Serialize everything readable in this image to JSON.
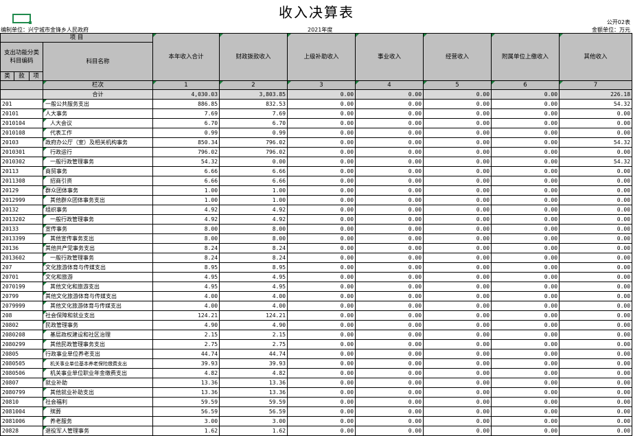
{
  "title": "收入决算表",
  "form_no": "公开02表",
  "unit_label": "编制单位：兴宁城市金锋乡人民政府",
  "year": "2021年度",
  "money_unit": "金额单位：万元",
  "header": {
    "item": "项    目",
    "func_code": "支出功能分类科目编码",
    "subject_name": "科目名称",
    "lei": "类",
    "kuan": "款",
    "xiang": "项",
    "lanci": "栏次",
    "columns": [
      "本年收入合计",
      "财政拨款收入",
      "上级补助收入",
      "事业收入",
      "经营收入",
      "附属单位上缴收入",
      "其他收入"
    ],
    "col_nums": [
      "1",
      "2",
      "3",
      "4",
      "5",
      "6",
      "7"
    ]
  },
  "total_label": "合计",
  "total_values": [
    "4,030.03",
    "3,803.85",
    "0.00",
    "0.00",
    "0.00",
    "0.00",
    "226.18"
  ],
  "rows": [
    {
      "code": "201",
      "name": "一般公共服务支出",
      "level": 1,
      "values": [
        "886.85",
        "832.53",
        "0.00",
        "0.00",
        "0.00",
        "0.00",
        "54.32"
      ]
    },
    {
      "code": "20101",
      "name": "人大事务",
      "level": 1,
      "values": [
        "7.69",
        "7.69",
        "0.00",
        "0.00",
        "0.00",
        "0.00",
        "0.00"
      ]
    },
    {
      "code": "2010104",
      "name": "人大会议",
      "level": 2,
      "values": [
        "6.70",
        "6.70",
        "0.00",
        "0.00",
        "0.00",
        "0.00",
        "0.00"
      ]
    },
    {
      "code": "2010108",
      "name": "代表工作",
      "level": 2,
      "values": [
        "0.99",
        "0.99",
        "0.00",
        "0.00",
        "0.00",
        "0.00",
        "0.00"
      ]
    },
    {
      "code": "20103",
      "name": "政府办公厅（室）及相关机构事务",
      "level": 1,
      "values": [
        "850.34",
        "796.02",
        "0.00",
        "0.00",
        "0.00",
        "0.00",
        "54.32"
      ]
    },
    {
      "code": "2010301",
      "name": "行政运行",
      "level": 2,
      "values": [
        "796.02",
        "796.02",
        "0.00",
        "0.00",
        "0.00",
        "0.00",
        "0.00"
      ]
    },
    {
      "code": "2010302",
      "name": "一般行政管理事务",
      "level": 2,
      "values": [
        "54.32",
        "0.00",
        "0.00",
        "0.00",
        "0.00",
        "0.00",
        "54.32"
      ]
    },
    {
      "code": "20113",
      "name": "商贸事务",
      "level": 1,
      "values": [
        "6.66",
        "6.66",
        "0.00",
        "0.00",
        "0.00",
        "0.00",
        "0.00"
      ]
    },
    {
      "code": "2011308",
      "name": "招商引资",
      "level": 2,
      "values": [
        "6.66",
        "6.66",
        "0.00",
        "0.00",
        "0.00",
        "0.00",
        "0.00"
      ]
    },
    {
      "code": "20129",
      "name": "群众团体事务",
      "level": 1,
      "values": [
        "1.00",
        "1.00",
        "0.00",
        "0.00",
        "0.00",
        "0.00",
        "0.00"
      ]
    },
    {
      "code": "2012999",
      "name": "其他群众团体事务支出",
      "level": 2,
      "values": [
        "1.00",
        "1.00",
        "0.00",
        "0.00",
        "0.00",
        "0.00",
        "0.00"
      ]
    },
    {
      "code": "20132",
      "name": "组织事务",
      "level": 1,
      "values": [
        "4.92",
        "4.92",
        "0.00",
        "0.00",
        "0.00",
        "0.00",
        "0.00"
      ]
    },
    {
      "code": "2013202",
      "name": "一般行政管理事务",
      "level": 2,
      "values": [
        "4.92",
        "4.92",
        "0.00",
        "0.00",
        "0.00",
        "0.00",
        "0.00"
      ]
    },
    {
      "code": "20133",
      "name": "宣传事务",
      "level": 1,
      "values": [
        "8.00",
        "8.00",
        "0.00",
        "0.00",
        "0.00",
        "0.00",
        "0.00"
      ]
    },
    {
      "code": "2013399",
      "name": "其他宣传事务支出",
      "level": 2,
      "values": [
        "8.00",
        "8.00",
        "0.00",
        "0.00",
        "0.00",
        "0.00",
        "0.00"
      ]
    },
    {
      "code": "20136",
      "name": "其他共产党事务支出",
      "level": 1,
      "values": [
        "8.24",
        "8.24",
        "0.00",
        "0.00",
        "0.00",
        "0.00",
        "0.00"
      ]
    },
    {
      "code": "2013602",
      "name": "一般行政管理事务",
      "level": 2,
      "values": [
        "8.24",
        "8.24",
        "0.00",
        "0.00",
        "0.00",
        "0.00",
        "0.00"
      ]
    },
    {
      "code": "207",
      "name": "文化旅游体育与传媒支出",
      "level": 1,
      "values": [
        "8.95",
        "8.95",
        "0.00",
        "0.00",
        "0.00",
        "0.00",
        "0.00"
      ]
    },
    {
      "code": "20701",
      "name": "文化和旅游",
      "level": 1,
      "values": [
        "4.95",
        "4.95",
        "0.00",
        "0.00",
        "0.00",
        "0.00",
        "0.00"
      ]
    },
    {
      "code": "2070199",
      "name": "其他文化和旅游支出",
      "level": 2,
      "values": [
        "4.95",
        "4.95",
        "0.00",
        "0.00",
        "0.00",
        "0.00",
        "0.00"
      ]
    },
    {
      "code": "20799",
      "name": "其他文化旅游体育与传媒支出",
      "level": 1,
      "values": [
        "4.00",
        "4.00",
        "0.00",
        "0.00",
        "0.00",
        "0.00",
        "0.00"
      ]
    },
    {
      "code": "2079999",
      "name": "其他文化旅游体育与传媒支出",
      "level": 2,
      "values": [
        "4.00",
        "4.00",
        "0.00",
        "0.00",
        "0.00",
        "0.00",
        "0.00"
      ]
    },
    {
      "code": "208",
      "name": "社会保障和就业支出",
      "level": 1,
      "values": [
        "124.21",
        "124.21",
        "0.00",
        "0.00",
        "0.00",
        "0.00",
        "0.00"
      ]
    },
    {
      "code": "20802",
      "name": "民政管理事务",
      "level": 1,
      "values": [
        "4.90",
        "4.90",
        "0.00",
        "0.00",
        "0.00",
        "0.00",
        "0.00"
      ]
    },
    {
      "code": "2080208",
      "name": "基层政权建设和社区治理",
      "level": 2,
      "values": [
        "2.15",
        "2.15",
        "0.00",
        "0.00",
        "0.00",
        "0.00",
        "0.00"
      ]
    },
    {
      "code": "2080299",
      "name": "其他民政管理事务支出",
      "level": 2,
      "values": [
        "2.75",
        "2.75",
        "0.00",
        "0.00",
        "0.00",
        "0.00",
        "0.00"
      ]
    },
    {
      "code": "20805",
      "name": "行政事业单位养老支出",
      "level": 1,
      "values": [
        "44.74",
        "44.74",
        "0.00",
        "0.00",
        "0.00",
        "0.00",
        "0.00"
      ]
    },
    {
      "code": "2080505",
      "name": "机关事业单位基本养老保险缴费支出",
      "level": 2,
      "small": true,
      "values": [
        "39.93",
        "39.93",
        "0.00",
        "0.00",
        "0.00",
        "0.00",
        "0.00"
      ]
    },
    {
      "code": "2080506",
      "name": "机关事业单位职业年金缴费支出",
      "level": 2,
      "values": [
        "4.82",
        "4.82",
        "0.00",
        "0.00",
        "0.00",
        "0.00",
        "0.00"
      ]
    },
    {
      "code": "20807",
      "name": "就业补助",
      "level": 1,
      "values": [
        "13.36",
        "13.36",
        "0.00",
        "0.00",
        "0.00",
        "0.00",
        "0.00"
      ]
    },
    {
      "code": "2080799",
      "name": "其他就业补助支出",
      "level": 2,
      "values": [
        "13.36",
        "13.36",
        "0.00",
        "0.00",
        "0.00",
        "0.00",
        "0.00"
      ]
    },
    {
      "code": "20810",
      "name": "社会福利",
      "level": 1,
      "values": [
        "59.59",
        "59.59",
        "0.00",
        "0.00",
        "0.00",
        "0.00",
        "0.00"
      ]
    },
    {
      "code": "2081004",
      "name": "殡葬",
      "level": 2,
      "values": [
        "56.59",
        "56.59",
        "0.00",
        "0.00",
        "0.00",
        "0.00",
        "0.00"
      ]
    },
    {
      "code": "2081006",
      "name": "养老服务",
      "level": 2,
      "values": [
        "3.00",
        "3.00",
        "0.00",
        "0.00",
        "0.00",
        "0.00",
        "0.00"
      ]
    },
    {
      "code": "20828",
      "name": "退役军人管理事务",
      "level": 1,
      "values": [
        "1.62",
        "1.62",
        "0.00",
        "0.00",
        "0.00",
        "0.00",
        "0.00"
      ]
    }
  ]
}
